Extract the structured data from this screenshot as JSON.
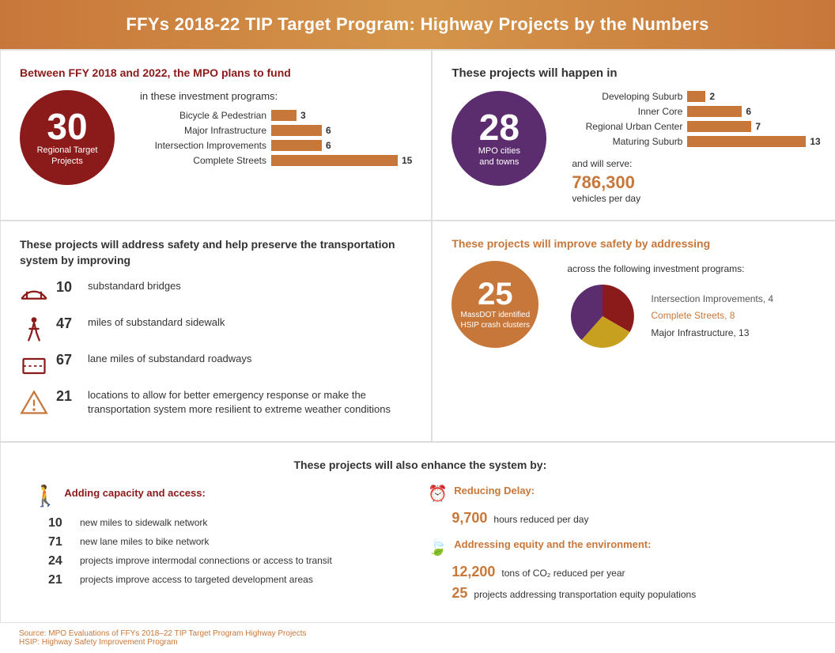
{
  "header": {
    "title": "FFYs 2018-22 TIP Target Program: Highway Projects by the Numbers"
  },
  "section1": {
    "title": "Between FFY 2018 and 2022, the MPO plans to fund",
    "circle_number": "30",
    "circle_label": "Regional Target\nProjects",
    "investment_intro": "in these investment programs:",
    "bars": [
      {
        "label": "Bicycle & Pedestrian",
        "value": 3,
        "max": 15
      },
      {
        "label": "Major Infrastructure",
        "value": 6,
        "max": 15
      },
      {
        "label": "Intersection Improvements",
        "value": 6,
        "max": 15
      },
      {
        "label": "Complete Streets",
        "value": 15,
        "max": 15
      }
    ]
  },
  "section2": {
    "title": "These projects will happen in",
    "circle_number": "28",
    "circle_label1": "MPO cities",
    "circle_label2": "and towns",
    "bars": [
      {
        "label": "Developing Suburb",
        "value": 2,
        "max": 13
      },
      {
        "label": "Inner Core",
        "value": 6,
        "max": 13
      },
      {
        "label": "Regional Urban Center",
        "value": 7,
        "max": 13
      },
      {
        "label": "Maturing Suburb",
        "value": 13,
        "max": 13
      }
    ],
    "serves_label": "and will serve:",
    "serves_number": "786,300",
    "serves_unit": "vehicles per day"
  },
  "section3": {
    "title": "These projects will address safety and help preserve the transportation system by improving",
    "items": [
      {
        "icon": "bridge",
        "number": "10",
        "text": "substandard bridges"
      },
      {
        "icon": "walk",
        "number": "47",
        "text": "miles of substandard sidewalk"
      },
      {
        "icon": "road",
        "number": "67",
        "text": "lane miles of substandard roadways"
      },
      {
        "icon": "warning",
        "number": "21",
        "text": "locations to allow for better emergency response or make the transportation system more resilient to extreme weather conditions"
      }
    ]
  },
  "section4": {
    "title": "These projects will improve safety by addressing",
    "circle_number": "25",
    "circle_label1": "MassDOT identified",
    "circle_label2": "HSIP crash clusters",
    "across_label": "across the following investment programs:",
    "investments": [
      {
        "label": "Intersection Improvements, 4",
        "color": "gray"
      },
      {
        "label": "Complete Streets, 8",
        "color": "orange"
      },
      {
        "label": "Major Infrastructure, 13",
        "color": "dark"
      }
    ]
  },
  "section5": {
    "title": "These projects will also enhance the system by:",
    "col1_subtitle": "Adding capacity and access:",
    "col1_items": [
      {
        "number": "10",
        "text": "new miles to sidewalk network"
      },
      {
        "number": "71",
        "text": "new lane miles to bike network"
      },
      {
        "number": "24",
        "text": "projects improve intermodal connections or access to transit"
      },
      {
        "number": "21",
        "text": "projects improve access to targeted development areas"
      }
    ],
    "col2_reduce_subtitle": "Reducing Delay:",
    "col2_reduce_number": "9,700",
    "col2_reduce_text": "hours reduced per day",
    "col2_equity_subtitle": "Addressing equity and the environment:",
    "col2_equity_items": [
      {
        "number": "12,200",
        "text": "tons of CO₂ reduced per year"
      },
      {
        "number": "25",
        "text": "projects addressing transportation equity populations"
      }
    ]
  },
  "footer": {
    "line1": "Source: MPO Evaluations of FFYs 2018–22 TIP Target Program Highway Projects",
    "line2": "HSIP: Highway Safety Improvement Program"
  },
  "colors": {
    "red": "#8b1a1a",
    "orange": "#c8773a",
    "purple": "#5c2d6e",
    "bar_color": "#c8773a"
  }
}
